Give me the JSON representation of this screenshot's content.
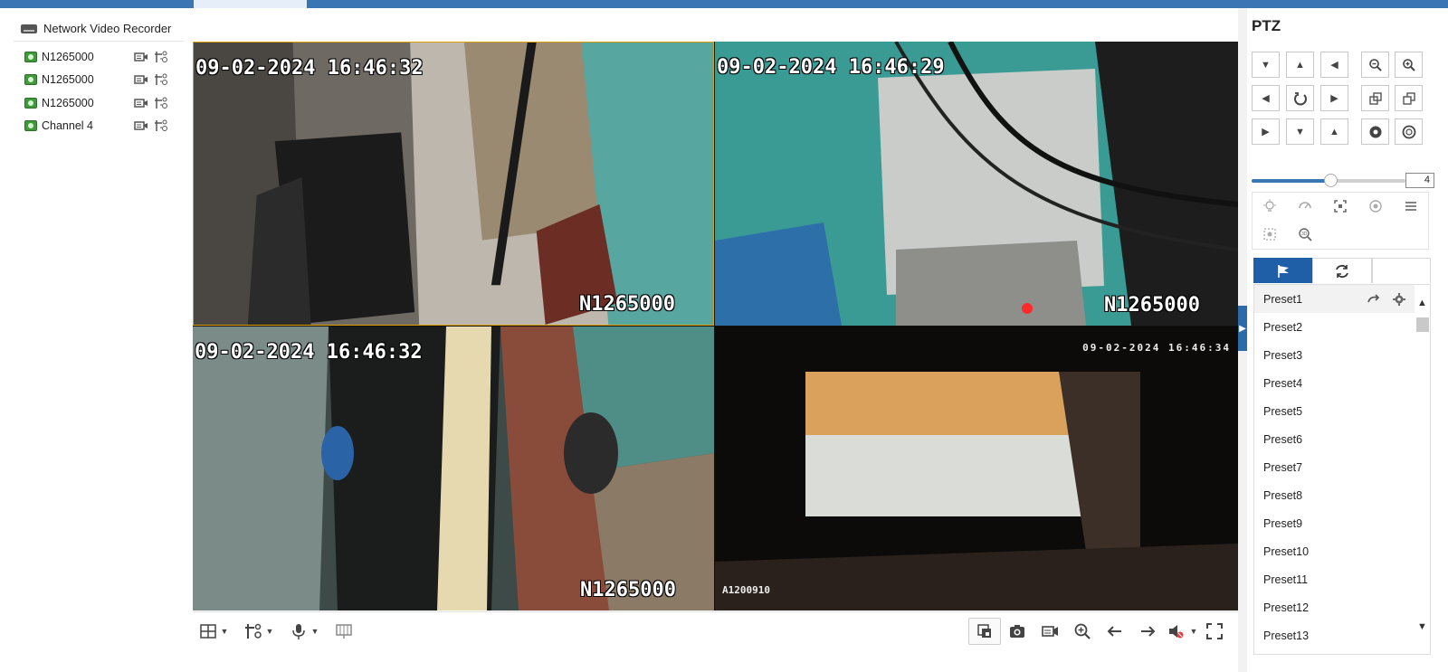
{
  "left_panel": {
    "title": "Network Video Recorder",
    "channels": [
      {
        "label": "N1265000"
      },
      {
        "label": "N1265000"
      },
      {
        "label": "N1265000"
      },
      {
        "label": "Channel 4"
      }
    ]
  },
  "tiles": [
    {
      "timestamp": "09-02-2024 16:46:32",
      "label": "N1265000",
      "selected": true
    },
    {
      "timestamp": "09-02-2024 16:46:29",
      "label": "N1265000",
      "selected": false
    },
    {
      "timestamp": "09-02-2024 16:46:32",
      "label": "N1265000",
      "selected": false
    },
    {
      "timestamp": "09-02-2024 16:46:34",
      "label": "A1200910",
      "selected": false
    }
  ],
  "ptz": {
    "title": "PTZ",
    "speed_value": "4",
    "speed_fraction": 0.52,
    "presets": [
      "Preset1",
      "Preset2",
      "Preset3",
      "Preset4",
      "Preset5",
      "Preset6",
      "Preset7",
      "Preset8",
      "Preset9",
      "Preset10",
      "Preset11",
      "Preset12",
      "Preset13"
    ]
  },
  "icons": {
    "layout": "layout-grid-icon",
    "stream": "stream-settings-icon",
    "mic": "microphone-icon",
    "capture": "capture-icon",
    "snapshot": "camera-icon",
    "record": "record-icon",
    "zoom": "zoom-icon",
    "prev": "arrow-left-icon",
    "next": "arrow-right-icon",
    "audio": "audio-mute-icon",
    "fullscreen": "fullscreen-icon"
  },
  "colors": {
    "accent": "#3b75b4",
    "tab_active": "#1e5fa8",
    "selected_tile_border": "#e0a100"
  }
}
